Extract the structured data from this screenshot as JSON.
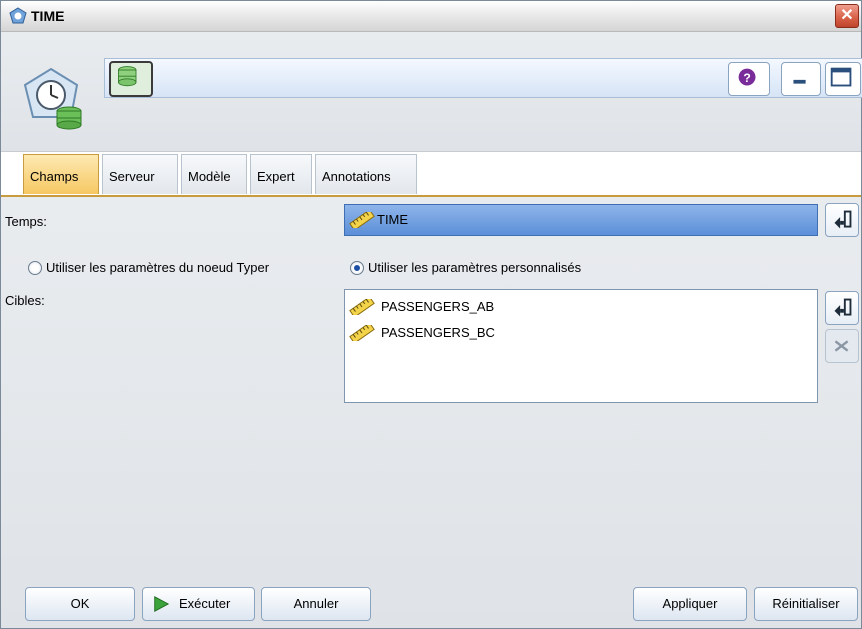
{
  "window": {
    "title": "TIME"
  },
  "tabs": [
    {
      "label": "Champs",
      "active": true
    },
    {
      "label": "Serveur"
    },
    {
      "label": "Modèle"
    },
    {
      "label": "Expert"
    },
    {
      "label": "Annotations"
    }
  ],
  "fields": {
    "time_label": "Temps:",
    "time_value": "TIME",
    "targets_label": "Cibles:",
    "targets": [
      "PASSENGERS_AB",
      "PASSENGERS_BC"
    ]
  },
  "options": {
    "radio_type_node": {
      "label": "Utiliser les paramètres du noeud Typer",
      "selected": false
    },
    "radio_custom": {
      "label": "Utiliser les paramètres personnalisés",
      "selected": true
    }
  },
  "buttons": {
    "ok": "OK",
    "run": "Exécuter",
    "cancel": "Annuler",
    "apply": "Appliquer",
    "reset": "Réinitialiser"
  },
  "colors": {
    "active_tab": "#f6c862",
    "selected_field": "#5b8fd8",
    "close_button": "#d9634a"
  },
  "icons": [
    "node-time-icon",
    "database-icon",
    "help-icon",
    "minimize-icon",
    "maximize-icon",
    "close-icon",
    "ruler-icon",
    "field-picker-icon",
    "delete-icon",
    "play-icon"
  ]
}
